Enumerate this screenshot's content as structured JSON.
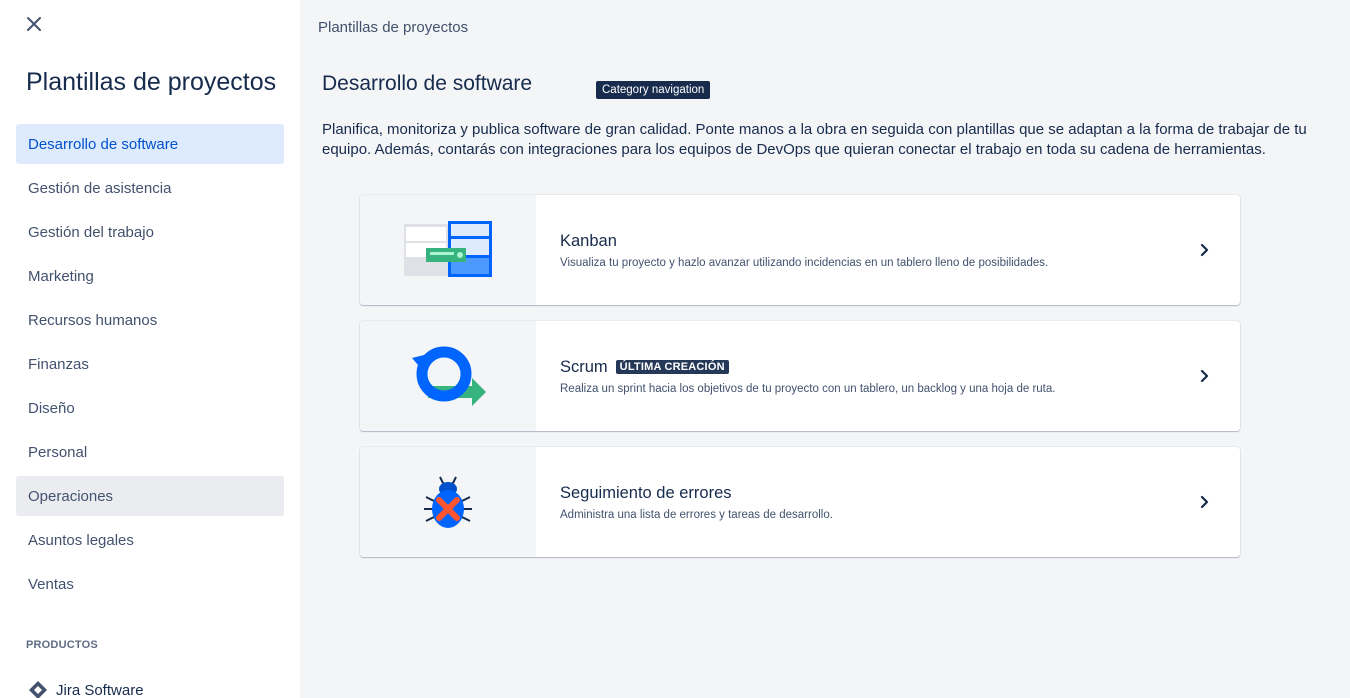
{
  "sidebar": {
    "close_icon": "close-icon",
    "title": "Plantillas de proyectos",
    "items": [
      {
        "label": "Desarrollo de software"
      },
      {
        "label": "Gestión de asistencia"
      },
      {
        "label": "Gestión del trabajo"
      },
      {
        "label": "Marketing"
      },
      {
        "label": "Recursos humanos"
      },
      {
        "label": "Finanzas"
      },
      {
        "label": "Diseño"
      },
      {
        "label": "Personal"
      },
      {
        "label": "Operaciones"
      },
      {
        "label": "Asuntos legales"
      },
      {
        "label": "Ventas"
      }
    ],
    "selected_index": 0,
    "products_label": "PRODUCTOS",
    "product": {
      "label": "Jira Software",
      "icon": "jira-software-icon"
    }
  },
  "main": {
    "breadcrumb": "Plantillas de proyectos",
    "category_title": "Desarrollo de software",
    "tooltip": "Category navigation",
    "description": "Planifica, monitoriza y publica software de gran calidad. Ponte manos a la obra en seguida con plantillas que se adaptan a la forma de trabajar de tu equipo. Además, contarás con integraciones para los equipos de DevOps que quieran conectar el trabajo en toda su cadena de herramientas.",
    "templates": [
      {
        "title": "Kanban",
        "description": "Visualiza tu proyecto y hazlo avanzar utilizando incidencias en un tablero lleno de posibilidades.",
        "icon": "kanban-board-illustration"
      },
      {
        "title": "Scrum",
        "badge": "ÚLTIMA CREACIÓN",
        "description": "Realiza un sprint hacia los objetivos de tu proyecto con un tablero, un backlog y una hoja de ruta.",
        "icon": "scrum-cycle-illustration"
      },
      {
        "title": "Seguimiento de errores",
        "description": "Administra una lista de errores y tareas de desarrollo.",
        "icon": "bug-illustration"
      }
    ]
  },
  "colors": {
    "selected_bg": "#DEEBFF",
    "selected_text": "#0052CC",
    "hover_bg": "#EBECF0",
    "text_primary": "#172B4D",
    "text_secondary": "#42526E",
    "badge_bg": "#253858",
    "canvas_bg": "#F4F5F7",
    "brand_blue": "#0065FF",
    "accent_green": "#36B37E",
    "error_red": "#FF5630"
  }
}
